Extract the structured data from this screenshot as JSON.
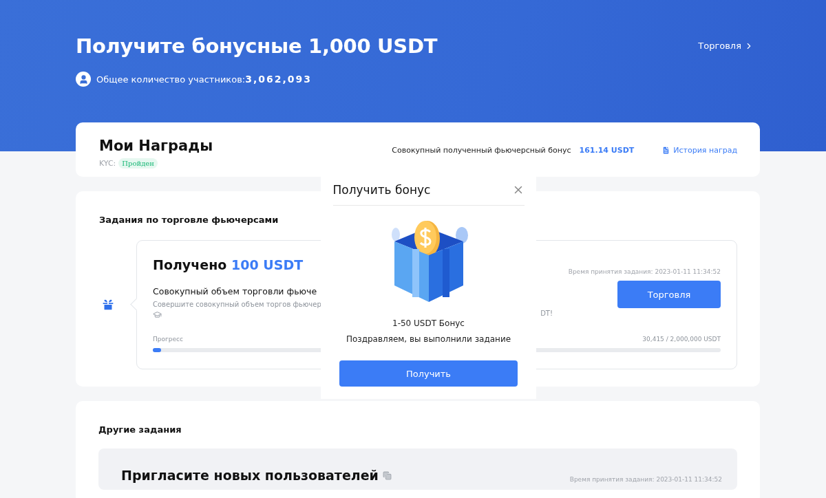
{
  "hero": {
    "title": "Получите бонусные 1,000 USDT",
    "participants_label": "Общее количество участников:",
    "participants_count": "3,062,093",
    "trade_link": "Торговля"
  },
  "rewards": {
    "title": "Мои Награды",
    "kyc_label": "KYC:",
    "kyc_status": "Пройден",
    "total_label": "Совокупный полученный фьючерсный бонус",
    "total_value": "161.14 USDT",
    "history_link": "История наград"
  },
  "futures_tasks": {
    "heading": "Задания по торговле фьючерсами",
    "task": {
      "title": "Получено",
      "reward": "100 USDT",
      "line": "Совокупный объем торговли фьюче",
      "hint": "Совершите совокупный объем торгов фьючер",
      "hint_tail": "DT!",
      "accepted": "Время принятия задания: 2023-01-11 11:34:52",
      "button": "Торговля",
      "progress_label": "Прогресс",
      "progress_value": "30,415 / 2,000,000 USDT",
      "level": 0.015
    }
  },
  "other_tasks": {
    "heading": "Другие задания",
    "task": {
      "title": "Пригласите новых пользователей",
      "accepted": "Время принятия задания: 2023-01-11 11:34:52"
    }
  },
  "modal": {
    "title": "Получить бонус",
    "amount": "1-50 USDT Бонус",
    "message": "Поздравляем, вы выполнили задание",
    "button": "Получить"
  }
}
